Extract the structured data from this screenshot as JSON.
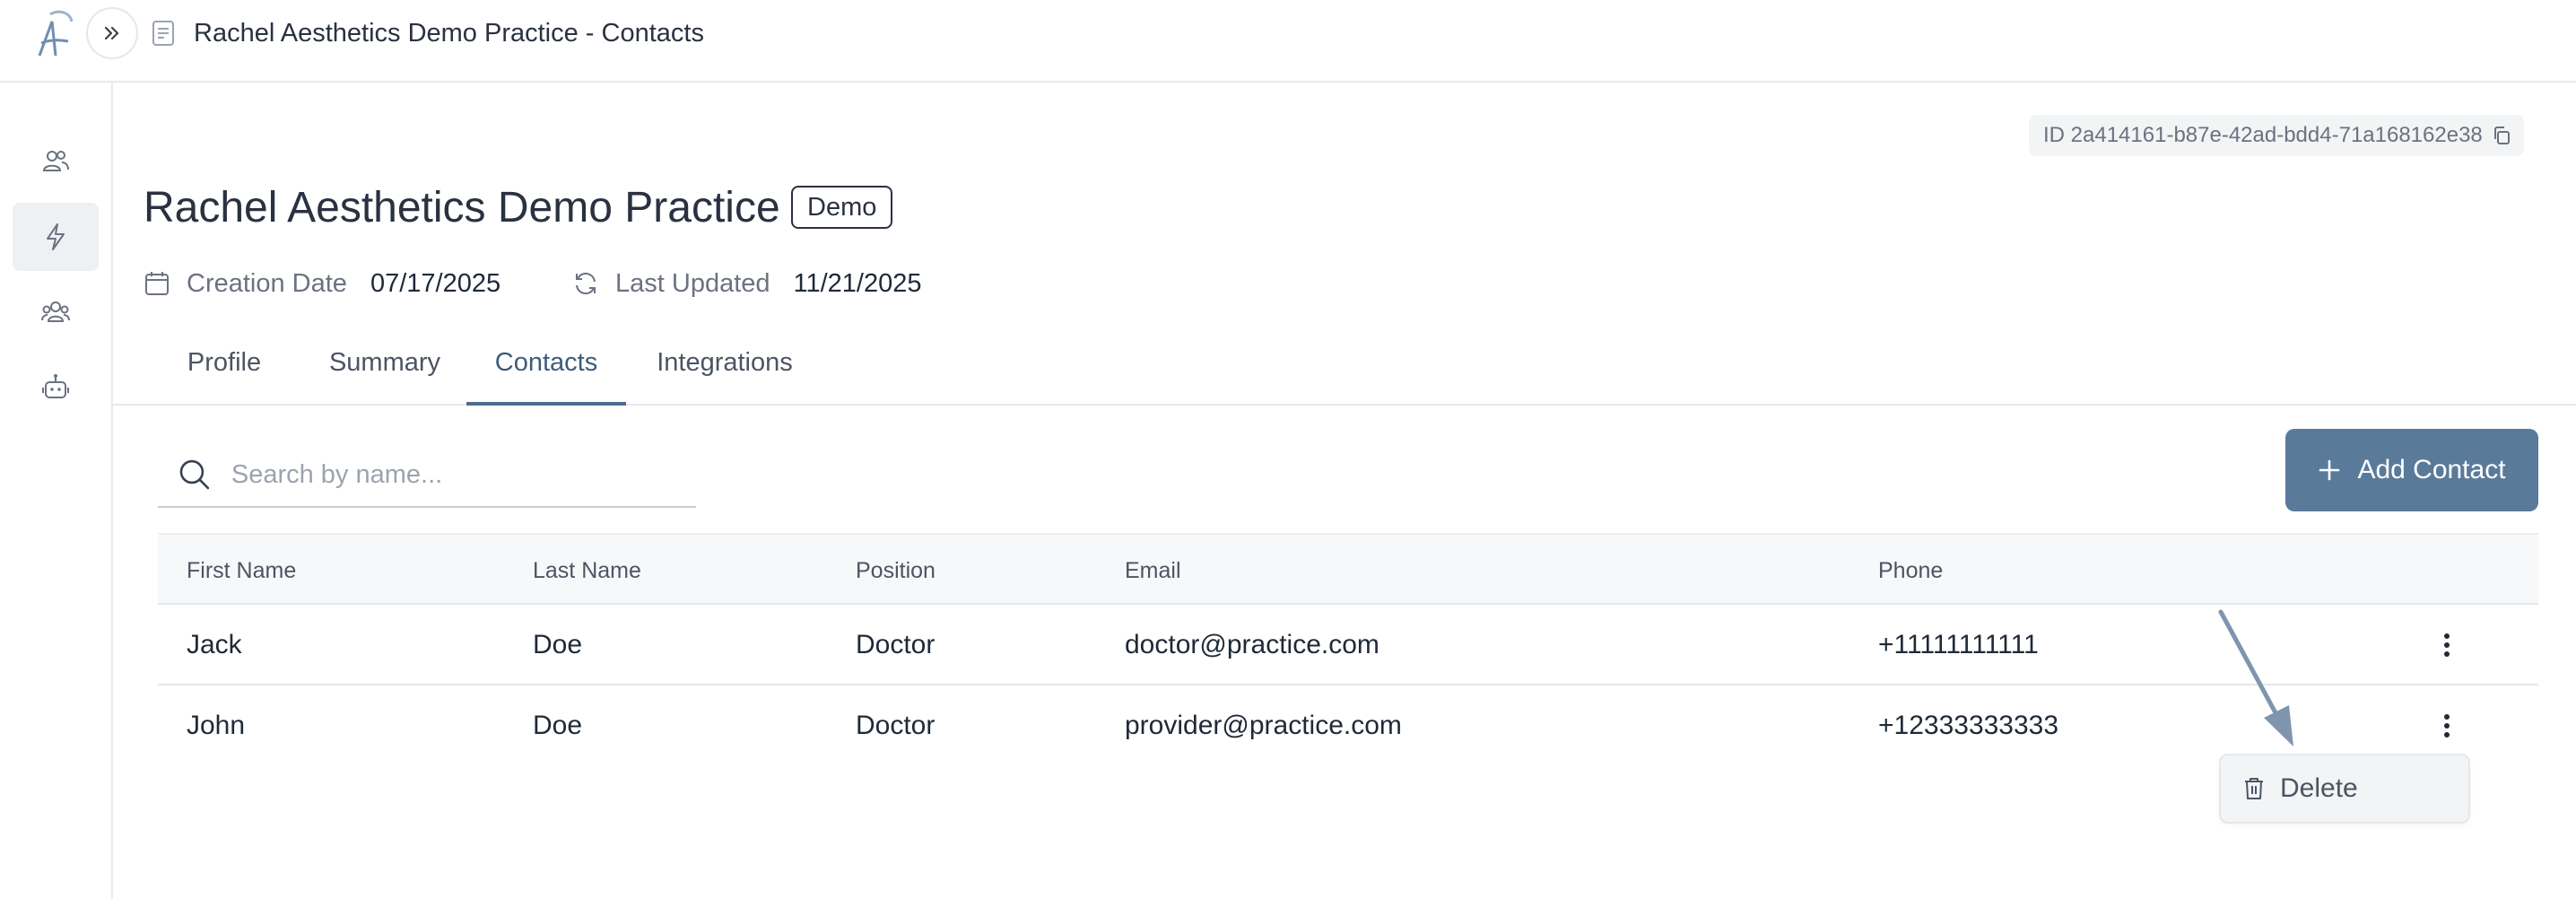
{
  "window": {
    "title": "Rachel Aesthetics Demo Practice - Contacts"
  },
  "header": {
    "id_chip": "ID 2a414161-b87e-42ad-bdd4-71a168162e38",
    "title": "Rachel Aesthetics Demo Practice",
    "badge": "Demo",
    "creation_label": "Creation Date",
    "creation_value": "07/17/2025",
    "updated_label": "Last Updated",
    "updated_value": "11/21/2025"
  },
  "tabs": [
    {
      "label": "Profile"
    },
    {
      "label": "Summary"
    },
    {
      "label": "Contacts",
      "active": true
    },
    {
      "label": "Integrations"
    }
  ],
  "search": {
    "placeholder": "Search by name...",
    "value": ""
  },
  "toolbar": {
    "add_label": "Add Contact"
  },
  "table": {
    "columns": [
      "First Name",
      "Last Name",
      "Position",
      "Email",
      "Phone"
    ],
    "rows": [
      {
        "first": "Jack",
        "last": "Doe",
        "position": "Doctor",
        "email": "doctor@practice.com",
        "phone": "+11111111111"
      },
      {
        "first": "John",
        "last": "Doe",
        "position": "Doctor",
        "email": "provider@practice.com",
        "phone": "+12333333333"
      }
    ]
  },
  "menu": {
    "delete_label": "Delete"
  },
  "icons": {
    "rail": [
      "users-icon",
      "bolt-icon",
      "group-icon",
      "robot-icon"
    ],
    "active_rail": "bolt-icon"
  },
  "colors": {
    "accent": "#5a7a9a",
    "tab_active": "#3e5c7a",
    "annotation_arrow": "#7f95ad"
  }
}
